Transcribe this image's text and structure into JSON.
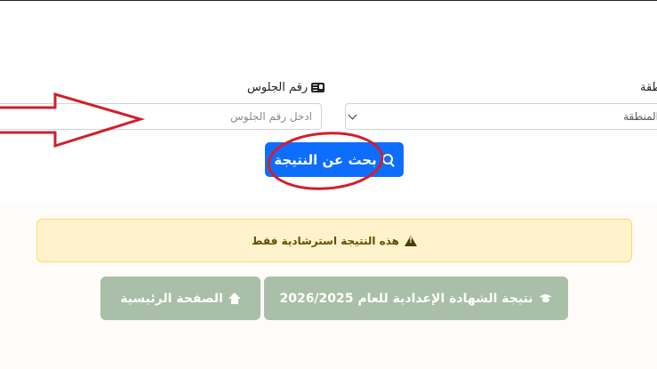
{
  "form": {
    "seat_label": "رقم الجلوس",
    "seat_placeholder": "ادخل رقم الجلوس",
    "region_label": "المنطقة",
    "region_selected": "المنطقة",
    "search_label": "بحث عن النتيجة"
  },
  "alert": {
    "text": "هذه النتيجة استرشادية فقط"
  },
  "nav": {
    "result_label": "نتيجة الشهادة الإعدادية للعام 2026/2025",
    "home_label": "الصفحة الرئيسية"
  },
  "colors": {
    "primary": "#0d6efd",
    "alert_bg": "#fff3cd",
    "alert_border": "#ffda6a",
    "nav_button": "#a9bfa7",
    "annotation": "#d0202a"
  },
  "icons": [
    "id-card-icon",
    "search-icon",
    "warning-icon",
    "graduation-cap-icon",
    "home-icon"
  ]
}
